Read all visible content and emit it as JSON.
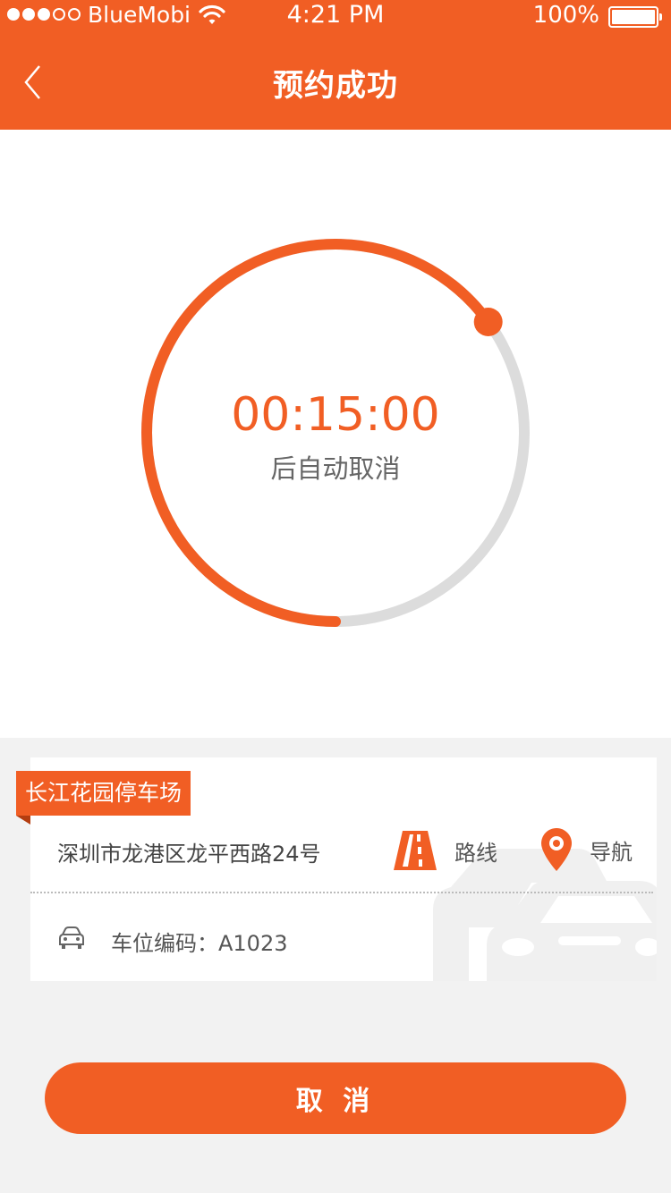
{
  "status_bar": {
    "carrier": "BlueMobi",
    "time": "4:21 PM",
    "battery": "100%",
    "signal_bars_filled": 3,
    "signal_bars_total": 5
  },
  "nav": {
    "title": "预约成功",
    "back_icon": "chevron-left-icon"
  },
  "timer": {
    "countdown": "00:15:00",
    "caption": "后自动取消",
    "progress": 0.65
  },
  "parking": {
    "name": "长江花园停车场",
    "address": "深圳市龙港区龙平西路24号",
    "route_label": "路线",
    "navigate_label": "导航",
    "spot_text": "车位编码：A1023"
  },
  "actions": {
    "cancel_label": "取 消"
  },
  "colors": {
    "accent": "#f15e24",
    "track": "#dddddd",
    "background": "#f2f2f2"
  }
}
